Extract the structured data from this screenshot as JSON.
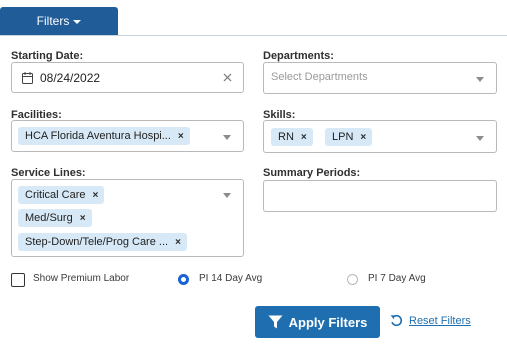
{
  "tab": {
    "label": "Filters"
  },
  "fields": {
    "starting_date": {
      "label": "Starting Date:",
      "value": "08/24/2022"
    },
    "departments": {
      "label": "Departments:",
      "placeholder": "Select Departments"
    },
    "facilities": {
      "label": "Facilities:",
      "chips": [
        "HCA Florida Aventura Hospi..."
      ]
    },
    "skills": {
      "label": "Skills:",
      "chips": [
        "RN",
        "LPN"
      ]
    },
    "service_lines": {
      "label": "Service Lines:",
      "chips": [
        "Critical Care",
        "Med/Surg",
        "Step-Down/Tele/Prog Care ..."
      ]
    },
    "summary_periods": {
      "label": "Summary Periods:",
      "value": ""
    }
  },
  "options": {
    "premium_labor": {
      "label": "Show Premium Labor",
      "checked": false
    },
    "pi_14": {
      "label": "PI 14 Day Avg",
      "selected": true
    },
    "pi_7": {
      "label": "PI 7 Day Avg",
      "selected": false
    }
  },
  "actions": {
    "apply": "Apply Filters",
    "reset": "Reset Filters"
  },
  "colors": {
    "primary": "#1f5c98",
    "button": "#1f6fb0",
    "chip": "#d7e9f6",
    "radio": "#1a62d4"
  },
  "icons": {
    "date": "calendar-icon",
    "clear": "close-icon",
    "apply": "filter-icon",
    "reset": "undo-icon"
  }
}
